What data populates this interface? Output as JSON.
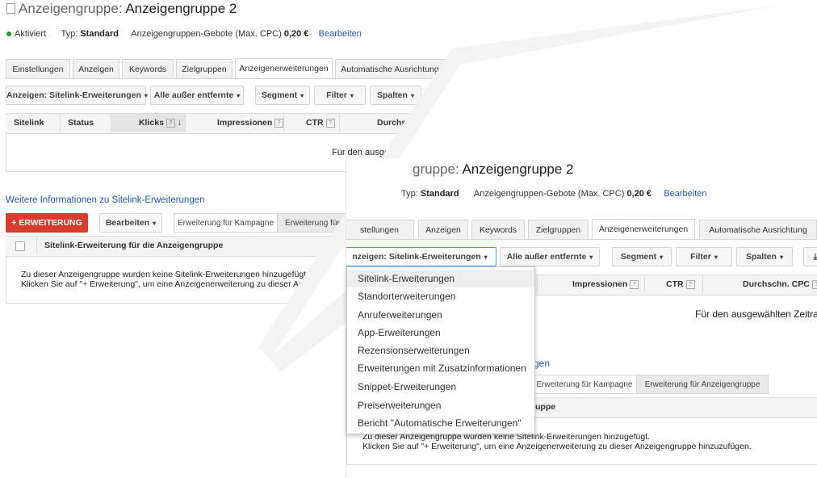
{
  "panel1": {
    "title_prefix": "Anzeigengruppe:",
    "title_name": "Anzeigengruppe 2",
    "status": "Aktiviert",
    "type_label": "Typ:",
    "type_value": "Standard",
    "bid_label": "Anzeigengruppen-Gebote (Max. CPC)",
    "bid_value": "0,20 €",
    "edit_link": "Bearbeiten",
    "tabs": [
      "Einstellungen",
      "Anzeigen",
      "Keywords",
      "Zielgruppen",
      "Anzeigenerweiterungen",
      "Automatische Ausrichtung"
    ],
    "toolbar": {
      "ads": "Anzeigen: Sitelink-Erweiterungen",
      "filter_all": "Alle außer entfernte",
      "segment": "Segment",
      "filter": "Filter",
      "columns": "Spalten"
    },
    "headers": {
      "sitelink": "Sitelink",
      "status": "Status",
      "clicks": "Klicks",
      "impressions": "Impressionen",
      "ctr": "CTR",
      "avg": "Durchschn"
    },
    "empty_text": "Für den ausge",
    "more_info": "Weitere Informationen zu Sitelink-Erweiterungen",
    "add_btn": "+ ERWEITERUNG",
    "edit_btn": "Bearbeiten",
    "seg_campaign": "Erweiterung für Kampagne",
    "seg_group": "Erweiterung für A",
    "section_head": "Sitelink-Erweiterung für die Anzeigengruppe",
    "msg1": "Zu dieser Anzeigengruppe wurden keine Sitelink-Erweiterungen hinzugefügt.",
    "msg2": "Klicken Sie auf \"+ Erweiterung\", um eine Anzeigenerweiterung zu dieser Anze"
  },
  "panel2": {
    "title_prefix": "gruppe:",
    "title_name": "Anzeigengruppe 2",
    "type_label": "Typ:",
    "type_value": "Standard",
    "bid_label": "Anzeigengruppen-Gebote (Max. CPC)",
    "bid_value": "0,20 €",
    "edit_link": "Bearbeiten",
    "tabs": [
      "stellungen",
      "Anzeigen",
      "Keywords",
      "Zielgruppen",
      "Anzeigenerweiterungen",
      "Automatische Ausrichtung"
    ],
    "toolbar": {
      "ads": "nzeigen: Sitelink-Erweiterungen",
      "filter_all": "Alle außer entfernte",
      "segment": "Segment",
      "filter": "Filter",
      "columns": "Spalten"
    },
    "headers": {
      "impressions": "Impressionen",
      "ctr": "CTR",
      "avg": "Durchschn. CPC"
    },
    "empty_text": "Für den ausgewählten Zeitrau",
    "more_info": "gen",
    "seg_campaign": "Erweiterung für Kampagne",
    "seg_group": "Erweiterung für Anzeigengruppe",
    "section_head": "uppe",
    "msg1": "Zu dieser Anzeigengruppe wurden keine Sitelink-Erweiterungen hinzugefügt.",
    "msg2": "Klicken Sie auf \"+ Erweiterung\", um eine Anzeigenerweiterung zu dieser Anzeigengruppe hinzuzufügen."
  },
  "dropdown": {
    "items": [
      "Sitelink-Erweiterungen",
      "Standorterweiterungen",
      "Anruferweiterungen",
      "App-Erweiterungen",
      "Rezensionserweiterungen",
      "Erweiterungen mit Zusatzinformationen",
      "Snippet-Erweiterungen",
      "Preiserweiterungen",
      "Bericht \"Automatische Erweiterungen\""
    ],
    "highlighted": 0
  },
  "colors": {
    "accent_link": "#2956b2",
    "add_button": "#d73b2f",
    "status_active": "#2a9d2a"
  }
}
